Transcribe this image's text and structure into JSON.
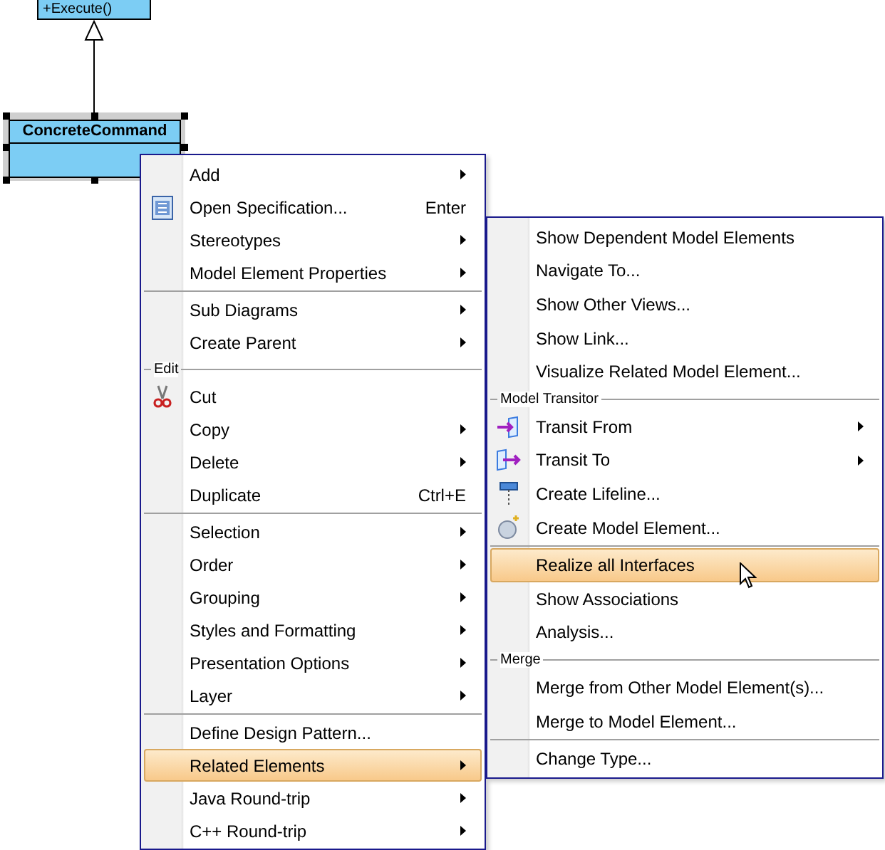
{
  "diagram": {
    "parent_class": {
      "operation": "+Execute()"
    },
    "selected_class": {
      "name": "ConcreteCommand",
      "selected": true
    }
  },
  "context_menu": {
    "items": [
      {
        "kind": "item",
        "label": "Add",
        "submenu": true,
        "selected": false
      },
      {
        "kind": "item",
        "label": "Open Specification...",
        "shortcut": "Enter",
        "submenu": false,
        "selected": false
      },
      {
        "kind": "item",
        "label": "Stereotypes",
        "submenu": true,
        "selected": false
      },
      {
        "kind": "item",
        "label": "Model Element Properties",
        "submenu": true,
        "selected": false
      },
      {
        "kind": "separator"
      },
      {
        "kind": "item",
        "label": "Sub Diagrams",
        "submenu": true,
        "selected": false
      },
      {
        "kind": "item",
        "label": "Create Parent",
        "submenu": true,
        "selected": false
      },
      {
        "kind": "group",
        "label": "Edit"
      },
      {
        "kind": "item",
        "label": "Cut",
        "submenu": false,
        "selected": false
      },
      {
        "kind": "item",
        "label": "Copy",
        "submenu": true,
        "selected": false
      },
      {
        "kind": "item",
        "label": "Delete",
        "submenu": true,
        "selected": false
      },
      {
        "kind": "item",
        "label": "Duplicate",
        "shortcut": "Ctrl+E",
        "submenu": false,
        "selected": false
      },
      {
        "kind": "separator"
      },
      {
        "kind": "item",
        "label": "Selection",
        "submenu": true,
        "selected": false
      },
      {
        "kind": "item",
        "label": "Order",
        "submenu": true,
        "selected": false
      },
      {
        "kind": "item",
        "label": "Grouping",
        "submenu": true,
        "selected": false
      },
      {
        "kind": "item",
        "label": "Styles and Formatting",
        "submenu": true,
        "selected": false
      },
      {
        "kind": "item",
        "label": "Presentation Options",
        "submenu": true,
        "selected": false
      },
      {
        "kind": "item",
        "label": "Layer",
        "submenu": true,
        "selected": false
      },
      {
        "kind": "separator"
      },
      {
        "kind": "item",
        "label": "Define Design Pattern...",
        "submenu": false,
        "selected": false
      },
      {
        "kind": "item",
        "label": "Related Elements",
        "submenu": true,
        "selected": true
      },
      {
        "kind": "item",
        "label": "Java Round-trip",
        "submenu": true,
        "selected": false
      },
      {
        "kind": "item",
        "label": "C++ Round-trip",
        "submenu": true,
        "selected": false
      }
    ]
  },
  "submenu": {
    "items": [
      {
        "kind": "item",
        "label": "Show Dependent Model Elements",
        "submenu": false,
        "selected": false
      },
      {
        "kind": "item",
        "label": "Navigate To...",
        "submenu": false,
        "selected": false
      },
      {
        "kind": "item",
        "label": "Show Other Views...",
        "submenu": false,
        "selected": false
      },
      {
        "kind": "item",
        "label": "Show Link...",
        "submenu": false,
        "selected": false
      },
      {
        "kind": "item",
        "label": "Visualize Related Model Element...",
        "submenu": false,
        "selected": false
      },
      {
        "kind": "group",
        "label": "Model Transitor"
      },
      {
        "kind": "item",
        "label": "Transit From",
        "submenu": true,
        "selected": false
      },
      {
        "kind": "item",
        "label": "Transit To",
        "submenu": true,
        "selected": false
      },
      {
        "kind": "item",
        "label": "Create Lifeline...",
        "submenu": false,
        "selected": false
      },
      {
        "kind": "item",
        "label": "Create Model Element...",
        "submenu": false,
        "selected": false
      },
      {
        "kind": "separator"
      },
      {
        "kind": "item",
        "label": "Realize all Interfaces",
        "submenu": false,
        "selected": true
      },
      {
        "kind": "item",
        "label": "Show Associations",
        "submenu": false,
        "selected": false
      },
      {
        "kind": "item",
        "label": "Analysis...",
        "submenu": false,
        "selected": false
      },
      {
        "kind": "group",
        "label": "Merge"
      },
      {
        "kind": "item",
        "label": "Merge from Other Model Element(s)...",
        "submenu": false,
        "selected": false
      },
      {
        "kind": "item",
        "label": "Merge to Model Element...",
        "submenu": false,
        "selected": false
      },
      {
        "kind": "separator"
      },
      {
        "kind": "item",
        "label": "Change Type...",
        "submenu": false,
        "selected": false
      }
    ]
  }
}
